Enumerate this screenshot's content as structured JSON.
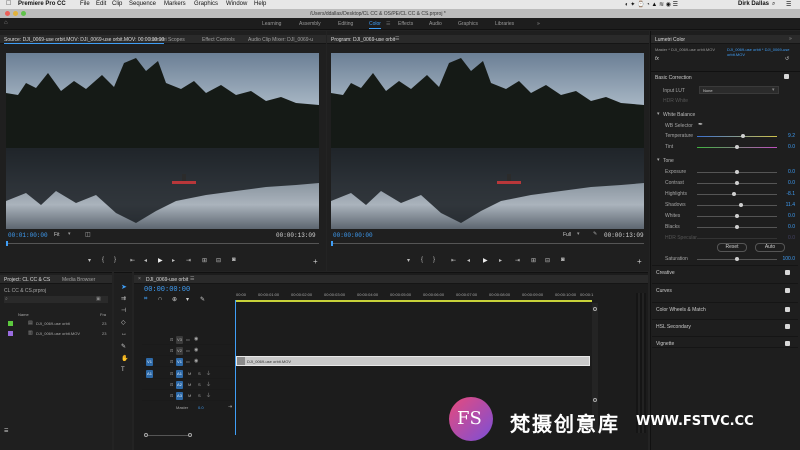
{
  "mac_menu": {
    "app_name": "Premiere Pro CC",
    "items": [
      "File",
      "Edit",
      "Clip",
      "Sequence",
      "Markers",
      "Graphics",
      "Window",
      "Help"
    ],
    "user": "Dirk Dallas"
  },
  "window_title": "/Users/ddallas/Desktop/CL CC & OS/PE/CL CC & CS.prproj *",
  "workspaces": [
    "Learning",
    "Assembly",
    "Editing",
    "Color",
    "Effects",
    "Audio",
    "Graphics",
    "Libraries"
  ],
  "active_workspace": "Color",
  "source_panel": {
    "tabs": [
      "Source: DJI_0069-use orbit.MOV: DJI_0069-use orbit.MOV: 00:00:00:00",
      "Lumetri Scopes",
      "Effect Controls",
      "Audio Clip Mixer: DJI_0069-u"
    ],
    "timecode_in": "00:01:00:00",
    "fit_label": "Fit",
    "full_label": "Full",
    "duration": "00:00:13:09"
  },
  "program_panel": {
    "tab": "Program: DJI_0069-use orbit",
    "timecode": "00:00:00:00",
    "fit_label": "Fit",
    "full_label": "Full",
    "duration": "00:00:13:09"
  },
  "lumetri": {
    "tab": "Lumetri Color",
    "clip_path": "Master * DJI_0069-use orbit.MOV",
    "clip_active": "DJI_0069-use orbit * DJI_0069-use orbit.MOV",
    "fx": "fx",
    "basic_correction": "Basic Correction",
    "input_lut_label": "Input LUT",
    "input_lut_value": "None",
    "hdr_white_label": "HDR White",
    "white_balance": "White Balance",
    "wb_selector": "WB Selector",
    "temperature": {
      "label": "Temperature",
      "value": "9.2"
    },
    "tint": {
      "label": "Tint",
      "value": "0.0"
    },
    "tone": "Tone",
    "tone_rows": [
      {
        "label": "Exposure",
        "value": "0.0"
      },
      {
        "label": "Contrast",
        "value": "0.0"
      },
      {
        "label": "Highlights",
        "value": "-8.1"
      },
      {
        "label": "Shadows",
        "value": "11.4"
      },
      {
        "label": "Whites",
        "value": "0.0"
      },
      {
        "label": "Blacks",
        "value": "0.0"
      },
      {
        "label": "HDR Specular",
        "value": "0.0"
      }
    ],
    "reset_label": "Reset",
    "auto_label": "Auto",
    "saturation": {
      "label": "Saturation",
      "value": "100.0"
    },
    "sections": [
      "Creative",
      "Curves",
      "Color Wheels & Match",
      "HSL Secondary",
      "Vignette"
    ]
  },
  "project_panel": {
    "tabs": [
      "Project: CL CC & CS",
      "Media Browser"
    ],
    "project_file": "CL CC & CS.prproj",
    "col_name": "Name",
    "col_fr": "Fra",
    "items": [
      {
        "name": "DJI_0069-use orbit",
        "fr": "23",
        "color": "#5cc93e"
      },
      {
        "name": "DJI_0069-use orbit.MOV",
        "fr": "23",
        "color": "#9a6ce0"
      }
    ]
  },
  "timeline": {
    "tab": "DJI_0069-use orbit",
    "timecode": "00:00:00:00",
    "ruler": [
      "00:00",
      "00:00:01:00",
      "00:00:02:00",
      "00:00:03:00",
      "00:00:04:00",
      "00:00:05:00",
      "00:00:06:00",
      "00:00:07:00",
      "00:00:08:00",
      "00:00:09:00",
      "00:00:10:00",
      "00:00:1"
    ],
    "video_tracks": [
      "V3",
      "V2",
      "V1"
    ],
    "audio_tracks": [
      "A1",
      "A2",
      "A3"
    ],
    "master_label": "Master",
    "master_value": "0.0",
    "clip_label": "DJI_0069-use orbit.MOV",
    "v1_source": "V1",
    "a1_source": "A1",
    "m": "M",
    "s": "S"
  },
  "watermark": {
    "logo": "FS",
    "cn": "梵摄创意库",
    "url": "WWW.FSTVC.CC"
  },
  "accent": "#3f9ef6"
}
